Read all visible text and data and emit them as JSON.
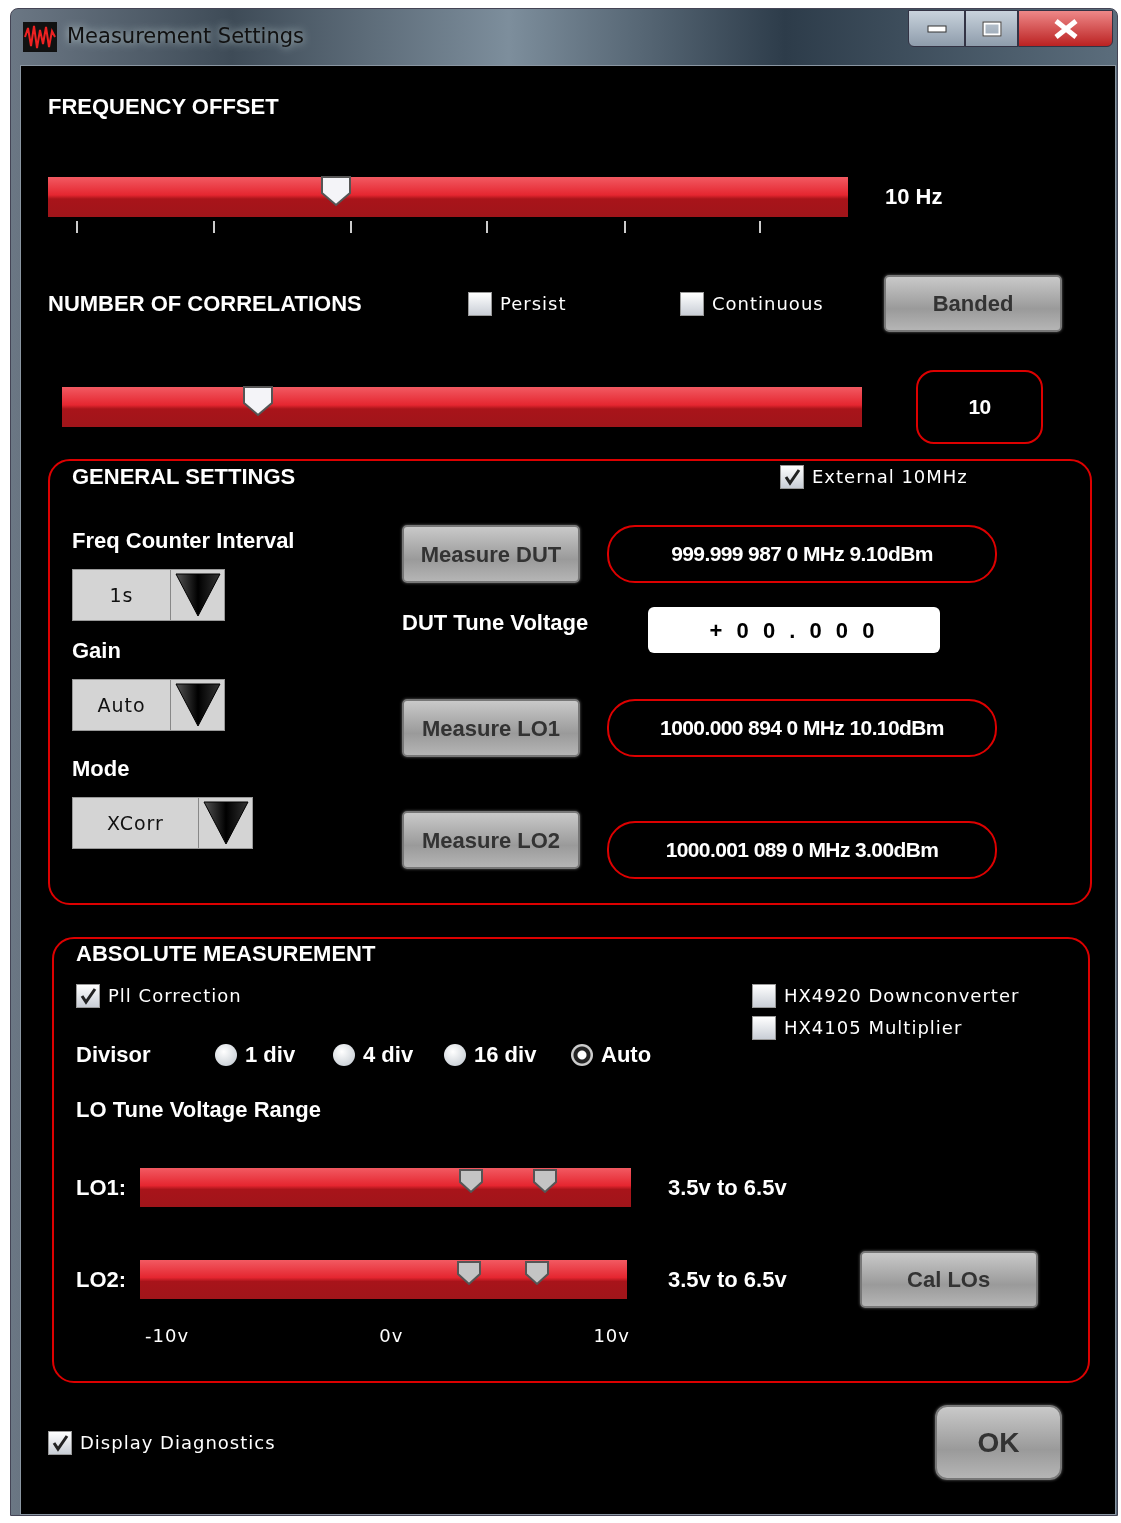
{
  "window": {
    "title": "Measurement Settings"
  },
  "frequency_offset": {
    "title": "FREQUENCY OFFSET",
    "slider": {
      "level": 0.36
    },
    "reading": "10 Hz"
  },
  "correlations": {
    "title": "NUMBER OF CORRELATIONS",
    "checkboxes": [
      {
        "label": "Persist",
        "checked": false
      },
      {
        "label": "Continuous",
        "checked": false
      }
    ],
    "button": "Banded",
    "slider": {
      "level": 0.245
    },
    "value": "10"
  },
  "general_settings": {
    "title": "GENERAL SETTINGS",
    "external": {
      "label": "External 10MHz",
      "checked": true
    },
    "dropdowns": [
      {
        "label": "Freq Counter Interval",
        "value": "1s"
      },
      {
        "label": "Gain",
        "value": "Auto"
      },
      {
        "label": "Mode",
        "value": "XCorr"
      }
    ],
    "measurements": [
      {
        "button": "Measure DUT",
        "reading": "999.999 987 0 MHz 9.10dBm"
      },
      {
        "button": "Measure LO1",
        "reading": "1000.000 894 0 MHz 10.10dBm"
      },
      {
        "button": "Measure LO2",
        "reading": "1000.001 089 0 MHz 3.00dBm"
      }
    ],
    "dut_tune_voltage": {
      "label": "DUT Tune Voltage",
      "value": "+ 0 0 . 0 0 0"
    }
  },
  "absolute_measurement": {
    "title": "ABSOLUTE MEASUREMENT",
    "pll": {
      "label": "Pll Correction",
      "checked": true
    },
    "options": [
      {
        "label": "HX4920 Downconverter",
        "checked": false
      },
      {
        "label": "HX4105 Multiplier",
        "checked": false
      }
    ],
    "divisor": {
      "label": "Divisor",
      "options": [
        {
          "label": "1 div",
          "selected": false
        },
        {
          "label": "4 div",
          "selected": false
        },
        {
          "label": "16 div",
          "selected": false
        },
        {
          "label": "Auto",
          "selected": true
        }
      ]
    },
    "range_title": "LO Tune Voltage Range",
    "ranges": [
      {
        "label": "LO1:",
        "low": {
          "level": 0.675
        },
        "high": {
          "level": 0.825
        },
        "reading": "3.5v to 6.5v"
      },
      {
        "label": "LO2:",
        "low": {
          "level": 0.675
        },
        "high": {
          "level": 0.815
        },
        "reading": "3.5v to 6.5v"
      }
    ],
    "axis_labels": [
      "-10v",
      "0v",
      "10v"
    ],
    "button": "Cal LOs"
  },
  "footer": {
    "diagnostics": {
      "label": "Display Diagnostics",
      "checked": true
    },
    "button": "OK"
  }
}
